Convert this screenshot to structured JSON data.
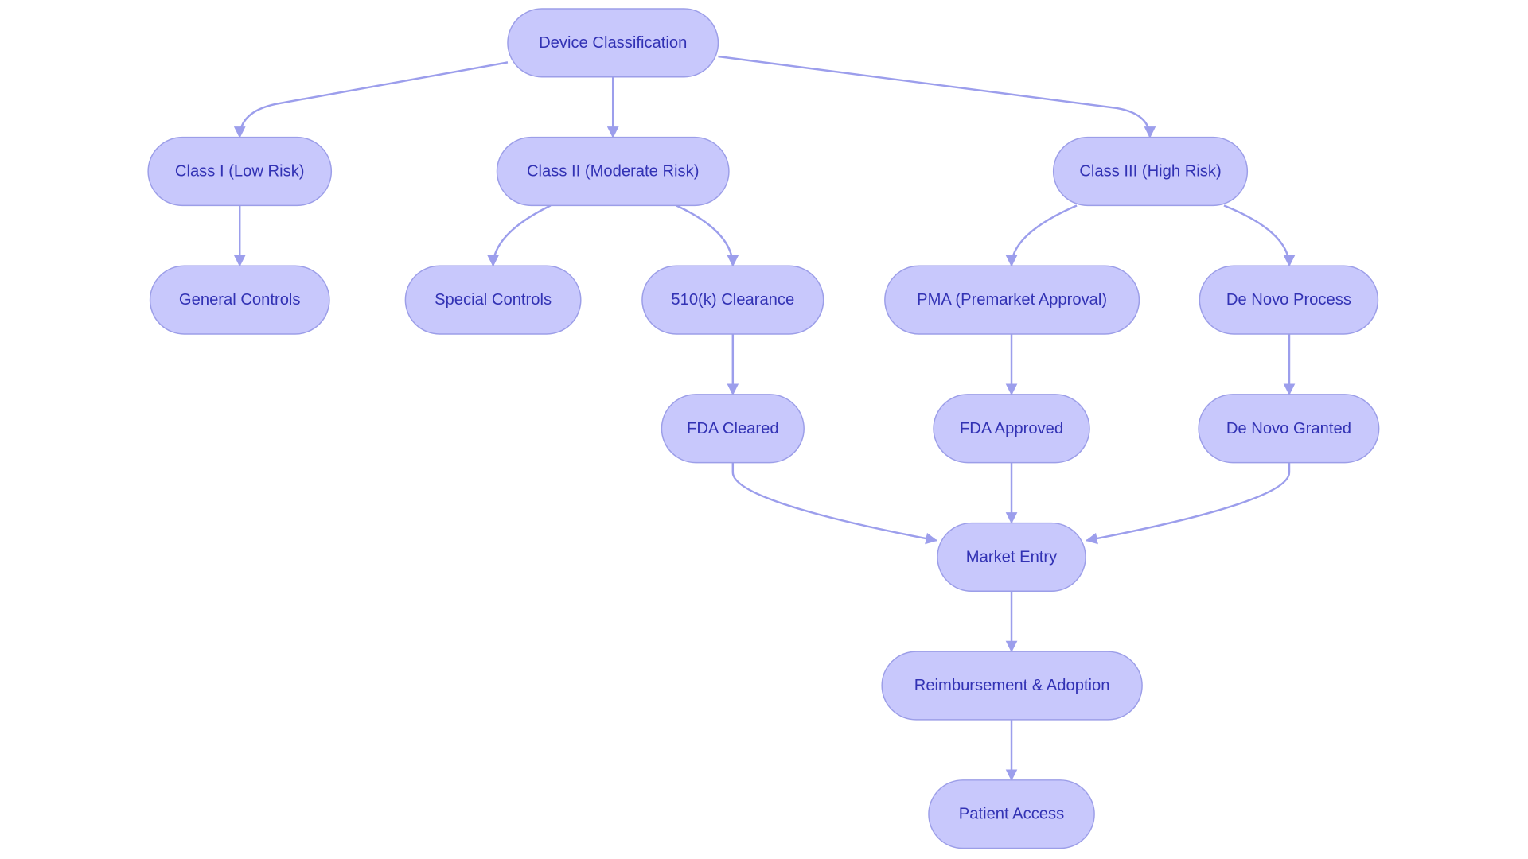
{
  "diagram": {
    "colors": {
      "node_fill": "#c8c8fc",
      "node_stroke": "#9c9ee8",
      "text": "#3232b4",
      "edge": "#9c9eec"
    },
    "nodes": [
      {
        "id": "device",
        "label": "Device Classification"
      },
      {
        "id": "class1",
        "label": "Class I (Low Risk)"
      },
      {
        "id": "class2",
        "label": "Class II (Moderate Risk)"
      },
      {
        "id": "class3",
        "label": "Class III (High Risk)"
      },
      {
        "id": "general",
        "label": "General Controls"
      },
      {
        "id": "special",
        "label": "Special Controls"
      },
      {
        "id": "k510",
        "label": "510(k) Clearance"
      },
      {
        "id": "pma",
        "label": "PMA (Premarket Approval)"
      },
      {
        "id": "denovo",
        "label": "De Novo Process"
      },
      {
        "id": "cleared",
        "label": "FDA Cleared"
      },
      {
        "id": "approved",
        "label": "FDA Approved"
      },
      {
        "id": "granted",
        "label": "De Novo Granted"
      },
      {
        "id": "market",
        "label": "Market Entry"
      },
      {
        "id": "reimb",
        "label": "Reimbursement & Adoption"
      },
      {
        "id": "patient",
        "label": "Patient Access"
      }
    ],
    "edges": [
      {
        "from": "device",
        "to": "class1"
      },
      {
        "from": "device",
        "to": "class2"
      },
      {
        "from": "device",
        "to": "class3"
      },
      {
        "from": "class1",
        "to": "general"
      },
      {
        "from": "class2",
        "to": "special"
      },
      {
        "from": "class2",
        "to": "k510"
      },
      {
        "from": "class3",
        "to": "pma"
      },
      {
        "from": "class3",
        "to": "denovo"
      },
      {
        "from": "k510",
        "to": "cleared"
      },
      {
        "from": "pma",
        "to": "approved"
      },
      {
        "from": "denovo",
        "to": "granted"
      },
      {
        "from": "cleared",
        "to": "market"
      },
      {
        "from": "approved",
        "to": "market"
      },
      {
        "from": "granted",
        "to": "market"
      },
      {
        "from": "market",
        "to": "reimb"
      },
      {
        "from": "reimb",
        "to": "patient"
      }
    ]
  }
}
